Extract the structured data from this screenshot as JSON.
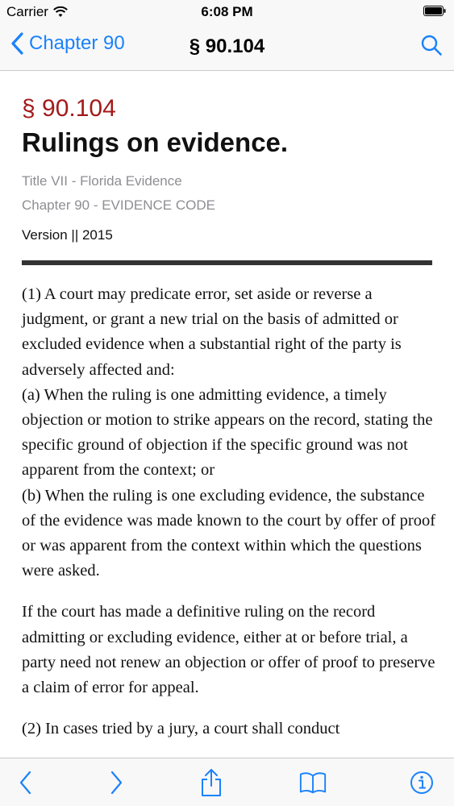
{
  "status_bar": {
    "carrier": "Carrier",
    "time": "6:08 PM"
  },
  "nav": {
    "back_label": "Chapter 90",
    "title": "§ 90.104",
    "accent_color": "#1a82fb"
  },
  "article": {
    "section_number": "§ 90.104",
    "section_title": "Rulings on evidence.",
    "title_line": "Title VII - Florida Evidence",
    "chapter_line": "Chapter 90 - EVIDENCE CODE",
    "version_line": "Version || 2015",
    "paragraphs": {
      "p1": "(1)   A court may predicate error, set aside or reverse a judgment, or grant a new trial on the basis of admitted or excluded evidence when a substantial right of the party is adversely affected and:",
      "p1a": "(a)   When the ruling is one admitting evidence, a timely objection or motion to strike appears on the record, stating the specific ground of objection if the specific ground was not apparent from the context; or",
      "p1b": "(b)   When the ruling is one excluding evidence, the substance of the evidence was made known to the court by offer of proof or was apparent from the context within which the questions were asked.",
      "p2": "If the court has made a definitive ruling on the record admitting or excluding evidence, either at or before trial, a party need not renew an objection or offer of proof to preserve a claim of error for appeal.",
      "p3_cut": "(2)   In cases tried by a jury, a court shall conduct"
    }
  },
  "toolbar": {
    "icons": [
      "back-arrow-icon",
      "forward-arrow-icon",
      "share-icon",
      "book-icon",
      "info-icon"
    ],
    "accent_color": "#1a82fb"
  }
}
